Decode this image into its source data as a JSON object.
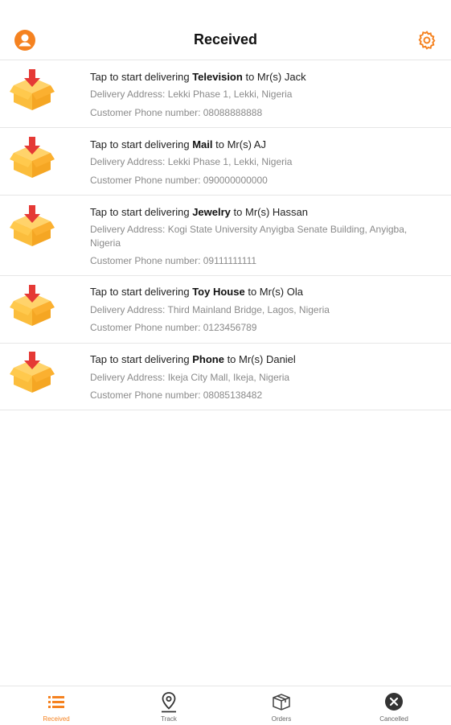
{
  "header": {
    "title": "Received",
    "profile_icon": "account-circle-icon",
    "settings_icon": "gear-icon"
  },
  "colors": {
    "accent": "#f58220",
    "box": "#fbbd3c",
    "arrow": "#e53935"
  },
  "deliveries": [
    {
      "prefix": "Tap to start delivering",
      "item": "Television",
      "suffix": "to Mr(s) Jack",
      "address": "Delivery Address: Lekki Phase 1, Lekki, Nigeria",
      "phone": "Customer Phone number: 08088888888"
    },
    {
      "prefix": "Tap to start delivering",
      "item": "Mail",
      "suffix": "to Mr(s) AJ",
      "address": "Delivery Address: Lekki Phase 1, Lekki, Nigeria",
      "phone": "Customer Phone number: 090000000000"
    },
    {
      "prefix": "Tap to start delivering",
      "item": "Jewelry",
      "suffix": " to Mr(s) Hassan",
      "address": "Delivery Address: Kogi State University Anyigba Senate Building, Anyigba, Nigeria",
      "phone": "Customer Phone number: 09111111111"
    },
    {
      "prefix": "Tap to start delivering",
      "item": "Toy House",
      "suffix": "to Mr(s) Ola",
      "address": "Delivery Address: Third Mainland Bridge, Lagos, Nigeria",
      "phone": "Customer Phone number: 0123456789"
    },
    {
      "prefix": "Tap to start delivering",
      "item": "Phone",
      "suffix": "to Mr(s) Daniel",
      "address": "Delivery Address: Ikeja City Mall, Ikeja, Nigeria",
      "phone": "Customer Phone number: 08085138482"
    }
  ],
  "nav": [
    {
      "label": "Received",
      "icon": "list-icon",
      "active": true
    },
    {
      "label": "Track",
      "icon": "map-pin-icon",
      "active": false
    },
    {
      "label": "Orders",
      "icon": "package-icon",
      "active": false
    },
    {
      "label": "Cancelled",
      "icon": "cancel-circle-icon",
      "active": false
    }
  ]
}
